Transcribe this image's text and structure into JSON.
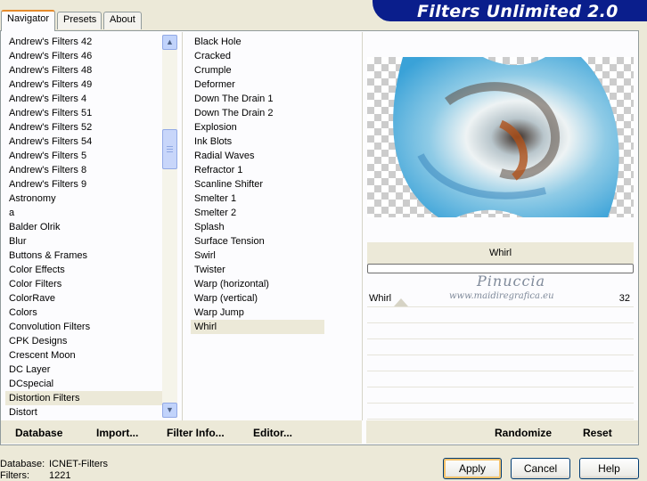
{
  "tabs": [
    {
      "label": "Navigator",
      "active": true
    },
    {
      "label": "Presets",
      "active": false
    },
    {
      "label": "About",
      "active": false
    }
  ],
  "app_title": "Filters Unlimited 2.0",
  "categories": [
    "Andrew's Filters 42",
    "Andrew's Filters 46",
    "Andrew's Filters 48",
    "Andrew's Filters 49",
    "Andrew's Filters 4",
    "Andrew's Filters 51",
    "Andrew's Filters 52",
    "Andrew's Filters 54",
    "Andrew's Filters 5",
    "Andrew's Filters 8",
    "Andrew's Filters 9",
    "Astronomy",
    "a",
    "Balder Olrik",
    "Blur",
    "Buttons & Frames",
    "Color Effects",
    "Color Filters",
    "ColorRave",
    "Colors",
    "Convolution Filters",
    "CPK Designs",
    "Crescent Moon",
    "DC Layer",
    "DCspecial",
    "Distortion Filters",
    "Distort"
  ],
  "selected_category": "Distortion Filters",
  "filters": [
    "Black Hole",
    "Cracked",
    "Crumple",
    "Deformer",
    "Down The Drain 1",
    "Down The Drain 2",
    "Explosion",
    "Ink Blots",
    "Radial Waves",
    "Refractor 1",
    "Scanline Shifter",
    "Smelter 1",
    "Smelter 2",
    "Splash",
    "Surface Tension",
    "Swirl",
    "Twister",
    "Warp (horizontal)",
    "Warp (vertical)",
    "Warp Jump",
    "Whirl"
  ],
  "selected_filter": "Whirl",
  "preview": {
    "filter_title": "Whirl"
  },
  "watermark": {
    "title": "Pinuccia",
    "url": "www.maidiregrafica.eu"
  },
  "parameters": [
    {
      "name": "Whirl",
      "value": "32"
    }
  ],
  "toolbar": {
    "database": "Database",
    "import": "Import...",
    "filter_info": "Filter Info...",
    "editor": "Editor...",
    "randomize": "Randomize",
    "reset": "Reset"
  },
  "status": {
    "database_label": "Database:",
    "database_value": "ICNET-Filters",
    "filters_label": "Filters:",
    "filters_value": "1221"
  },
  "dialog_buttons": {
    "apply": "Apply",
    "cancel": "Cancel",
    "help": "Help"
  }
}
